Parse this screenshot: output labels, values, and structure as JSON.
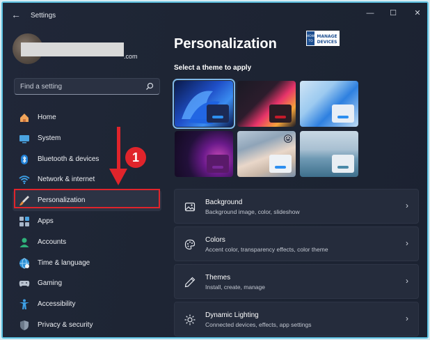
{
  "window": {
    "title": "Settings",
    "back_glyph": "←",
    "minimize_glyph": "—",
    "maximize_glyph": "☐",
    "close_glyph": "✕"
  },
  "profile": {
    "email_suffix": ".com"
  },
  "search": {
    "placeholder": "Find a setting"
  },
  "sidebar": {
    "items": [
      {
        "label": "Home",
        "icon": "home-icon"
      },
      {
        "label": "System",
        "icon": "system-icon"
      },
      {
        "label": "Bluetooth & devices",
        "icon": "bluetooth-icon"
      },
      {
        "label": "Network & internet",
        "icon": "wifi-icon"
      },
      {
        "label": "Personalization",
        "icon": "brush-icon",
        "selected": true
      },
      {
        "label": "Apps",
        "icon": "apps-icon"
      },
      {
        "label": "Accounts",
        "icon": "accounts-icon"
      },
      {
        "label": "Time & language",
        "icon": "globe-icon"
      },
      {
        "label": "Gaming",
        "icon": "gamepad-icon"
      },
      {
        "label": "Accessibility",
        "icon": "accessibility-icon"
      },
      {
        "label": "Privacy & security",
        "icon": "shield-icon"
      }
    ]
  },
  "annotation": {
    "step_number": "1",
    "color": "#e0242b"
  },
  "main": {
    "title": "Personalization",
    "themes_heading": "Select a theme to apply",
    "cards": [
      {
        "title": "Background",
        "subtitle": "Background image, color, slideshow",
        "icon": "image-icon"
      },
      {
        "title": "Colors",
        "subtitle": "Accent color, transparency effects, color theme",
        "icon": "palette-icon"
      },
      {
        "title": "Themes",
        "subtitle": "Install, create, manage",
        "icon": "pen-icon"
      },
      {
        "title": "Dynamic Lighting",
        "subtitle": "Connected devices, effects, app settings",
        "icon": "lighting-icon"
      }
    ],
    "chevron_glyph": "›"
  },
  "colors": {
    "accent": "#0078d4",
    "window_bg": "#1e2534",
    "card_bg": "#252c3c"
  }
}
